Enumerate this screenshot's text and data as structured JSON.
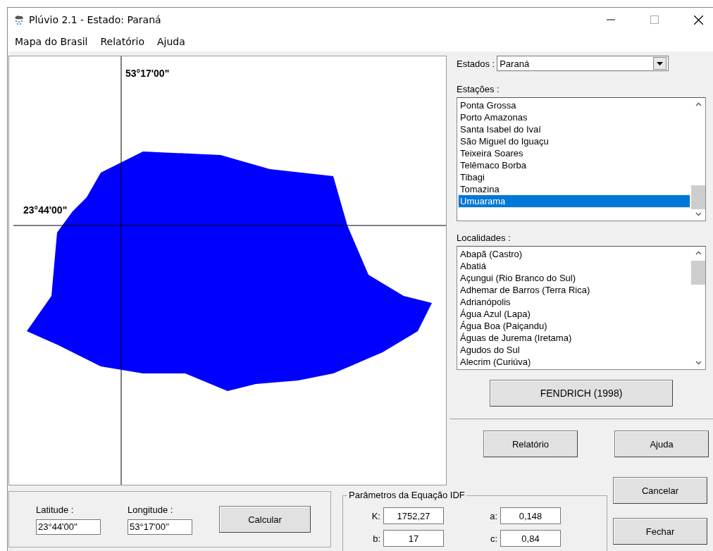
{
  "window": {
    "title": "Plúvio 2.1 - Estado: Paraná"
  },
  "menu": [
    {
      "label": "Mapa do Brasil"
    },
    {
      "label": "Relatório"
    },
    {
      "label": "Ajuda"
    }
  ],
  "map": {
    "longitude_label": "53°17'00\"",
    "latitude_label": "23°44'00\""
  },
  "estados": {
    "label": "Estados :",
    "value": "Paraná"
  },
  "estacoes": {
    "label": "Estações :",
    "items": [
      {
        "label": "Ponta Grossa",
        "selected": false
      },
      {
        "label": "Porto Amazonas",
        "selected": false
      },
      {
        "label": "Santa Isabel do Ivaí",
        "selected": false
      },
      {
        "label": "São Miguel do Iguaçu",
        "selected": false
      },
      {
        "label": "Teixeira Soares",
        "selected": false
      },
      {
        "label": "Telêmaco Borba",
        "selected": false
      },
      {
        "label": "Tibagi",
        "selected": false
      },
      {
        "label": "Tomazina",
        "selected": false
      },
      {
        "label": "Umuarama",
        "selected": true
      }
    ]
  },
  "localidades": {
    "label": "Localidades :",
    "items": [
      {
        "label": "Abapã (Castro)",
        "selected": false
      },
      {
        "label": "Abatiá",
        "selected": false
      },
      {
        "label": "Açungui (Rio Branco do Sul)",
        "selected": false
      },
      {
        "label": "Adhemar de Barros (Terra Rica)",
        "selected": false
      },
      {
        "label": "Adrianópolis",
        "selected": false
      },
      {
        "label": "Água Azul (Lapa)",
        "selected": false
      },
      {
        "label": "Água Boa (Paiçandu)",
        "selected": false
      },
      {
        "label": "Águas de Jurema (Iretama)",
        "selected": false
      },
      {
        "label": "Agudos do Sul",
        "selected": false
      },
      {
        "label": "Alecrim (Curiúva)",
        "selected": false
      }
    ]
  },
  "method_button": {
    "label": "FENDRICH (1998)"
  },
  "buttons": [
    {
      "label": "Relatório"
    },
    {
      "label": "Ajuda"
    },
    {
      "label": "Cancelar"
    },
    {
      "label": "Fechar"
    }
  ],
  "coordinates": {
    "latitude": {
      "label": "Latitude :",
      "value": "23°44'00''"
    },
    "longitude": {
      "label": "Longitude :",
      "value": "53°17'00''"
    },
    "calculate": {
      "label": "Calcular"
    }
  },
  "idf": {
    "title": "Parâmetros da Equação IDF",
    "params": [
      {
        "name": "K:",
        "value": "1752,27"
      },
      {
        "name": "a:",
        "value": "0,148"
      },
      {
        "name": "b:",
        "value": "17"
      },
      {
        "name": "c:",
        "value": "0,84"
      }
    ]
  }
}
